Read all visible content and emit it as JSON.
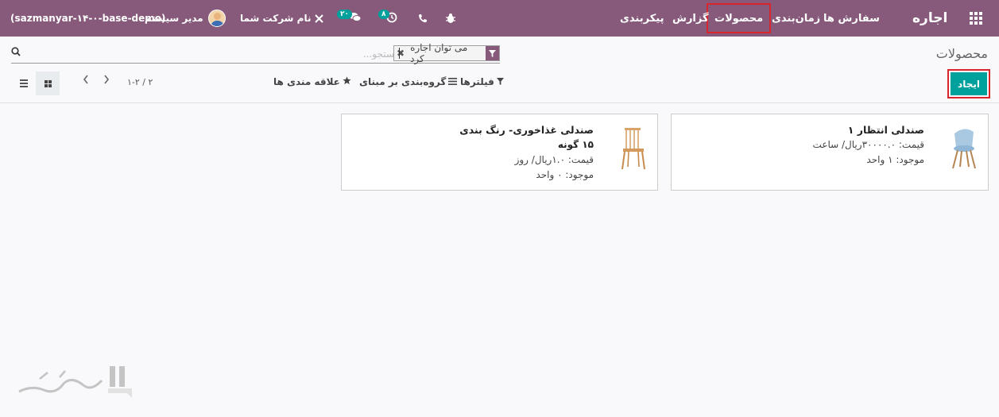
{
  "navbar": {
    "app_name": "اجاره",
    "menu": [
      "سفارش ها",
      "زمان‌بندی",
      "محصولات",
      "گزارش",
      "پیکربندی"
    ],
    "bug_icon": "bug-icon",
    "phone_icon": "phone-icon",
    "activity_badge": "۸",
    "messages_badge": "۲۰",
    "company_name": "نام شرکت شما",
    "user_name": "مدیر سیستم",
    "database": "(sazmanyar-۱۴-۰-base-demo)"
  },
  "control_panel": {
    "breadcrumb": "محصولات",
    "search_placeholder": "جستجو...",
    "facet_label": "می توان اجاره کرد",
    "create_label": "ایجاد",
    "filters_label": "فیلترها",
    "group_by_label": "گروه‌بندی بر مبنای",
    "favorites_label": "علاقه مندی ها",
    "pager": "۱-۲ / ۲"
  },
  "cards": [
    {
      "title": "صندلی انتظار ۱",
      "price": "قیمت: ۳۰۰۰۰.۰ریال/ ساعت",
      "stock": "موجود: ۱ واحد"
    },
    {
      "title": "صندلی غذاخوری- رنگ بندی",
      "variants": "۱۵ گونه",
      "price": "قیمت: ۱.۰ریال/ روز",
      "stock": "موجود: ۰ واحد"
    }
  ],
  "colors": {
    "brand": "#875a7b",
    "primary": "#00a09d",
    "highlight": "#d9262c"
  }
}
